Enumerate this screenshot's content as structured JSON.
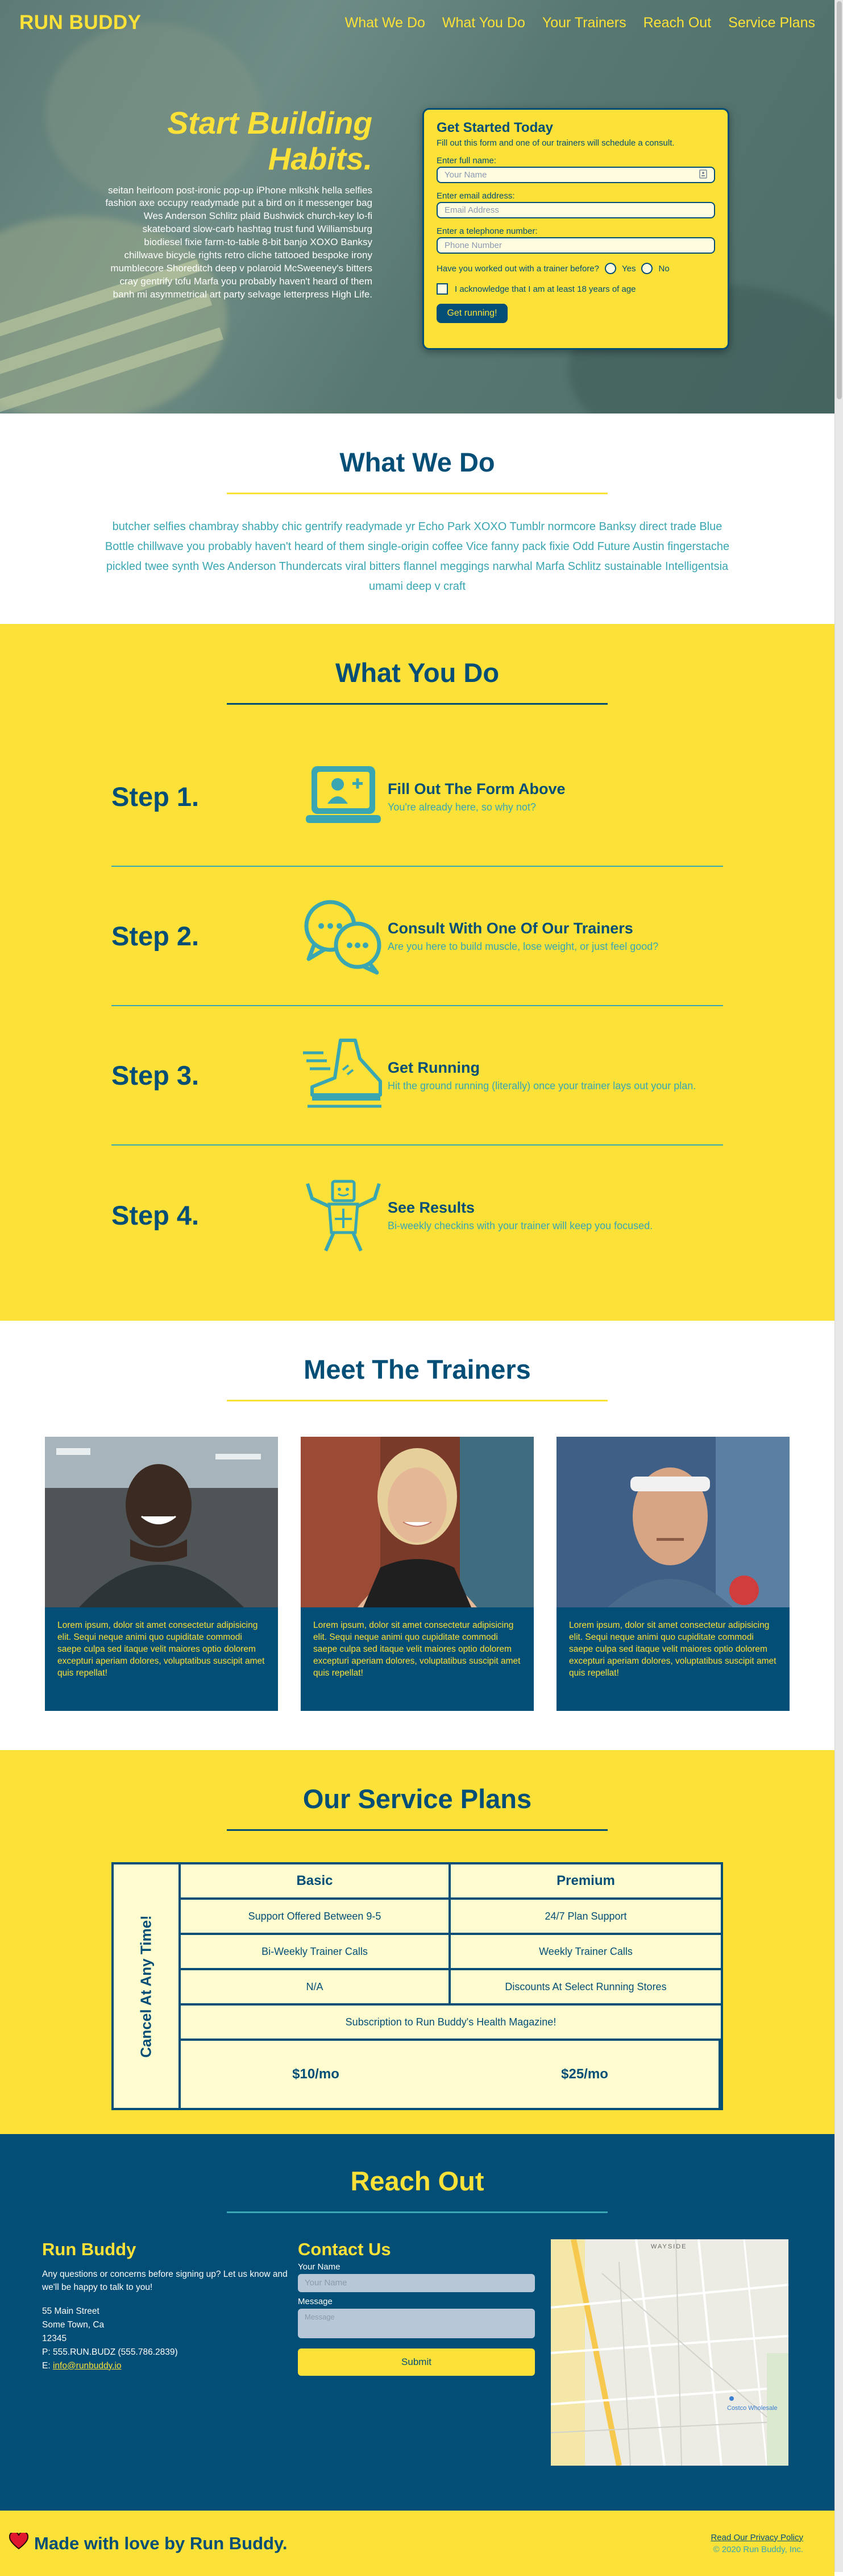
{
  "header": {
    "logo": "RUN BUDDY",
    "nav": [
      "What We Do",
      "What You Do",
      "Your Trainers",
      "Reach Out",
      "Service Plans"
    ]
  },
  "hero": {
    "title": "Start Building Habits.",
    "text": "seitan heirloom post-ironic pop-up iPhone mlkshk hella selfies fashion axe occupy readymade put a bird on it messenger bag Wes Anderson Schlitz plaid Bushwick church-key lo-fi skateboard slow-carb hashtag trust fund Williamsburg biodiesel fixie farm-to-table 8-bit banjo XOXO Banksy chillwave bicycle rights retro cliche tattooed bespoke irony mumblecore Shoreditch deep v polaroid McSweeney's bitters cray gentrify tofu Marfa you probably haven't heard of them banh mi asymmetrical art party selvage letterpress High Life."
  },
  "signup": {
    "title": "Get Started Today",
    "subtitle": "Fill out this form and one of our trainers will schedule a consult.",
    "name_label": "Enter full name:",
    "name_placeholder": "Your Name",
    "email_label": "Enter email address:",
    "email_placeholder": "Email Address",
    "phone_label": "Enter a telephone number:",
    "phone_placeholder": "Phone Number",
    "question": "Have you worked out with a trainer before?",
    "yes": "Yes",
    "no": "No",
    "ack": "I acknowledge that I am at least 18 years of age",
    "button": "Get running!"
  },
  "what_we_do": {
    "title": "What We Do",
    "text": "butcher selfies chambray shabby chic gentrify readymade yr Echo Park XOXO Tumblr normcore Banksy direct trade Blue Bottle chillwave you probably haven't heard of them single-origin coffee Vice fanny pack fixie Odd Future Austin fingerstache pickled twee synth Wes Anderson Thundercats viral bitters flannel meggings narwhal Marfa Schlitz sustainable Intelligentsia umami deep v craft"
  },
  "what_you_do": {
    "title": "What You Do",
    "steps": [
      {
        "num": "Step 1.",
        "title": "Fill Out The Form Above",
        "desc": "You're already here, so why not?",
        "icon": "laptop-user-icon"
      },
      {
        "num": "Step 2.",
        "title": "Consult With One Of Our Trainers",
        "desc": "Are you here to build muscle, lose weight, or just feel good?",
        "icon": "chat-bubbles-icon"
      },
      {
        "num": "Step 3.",
        "title": "Get Running",
        "desc": "Hit the ground running (literally) once your trainer lays out your plan.",
        "icon": "running-shoe-icon"
      },
      {
        "num": "Step 4.",
        "title": "See Results",
        "desc": "Bi-weekly checkins with your trainer will keep you focused.",
        "icon": "strong-body-icon"
      }
    ]
  },
  "trainers": {
    "title": "Meet The Trainers",
    "cards": [
      {
        "text": "Lorem ipsum, dolor sit amet consectetur adipisicing elit. Sequi neque animi quo cupiditate commodi saepe culpa sed itaque velit maiores optio dolorem excepturi aperiam dolores, voluptatibus suscipit amet quis repellat!"
      },
      {
        "text": "Lorem ipsum, dolor sit amet consectetur adipisicing elit. Sequi neque animi quo cupiditate commodi saepe culpa sed itaque velit maiores optio dolorem excepturi aperiam dolores, voluptatibus suscipit amet quis repellat!"
      },
      {
        "text": "Lorem ipsum, dolor sit amet consectetur adipisicing elit. Sequi neque animi quo cupiditate commodi saepe culpa sed itaque velit maiores optio dolorem excepturi aperiam dolores, voluptatibus suscipit amet quis repellat!"
      }
    ]
  },
  "plans": {
    "title": "Our Service Plans",
    "side": "Cancel At Any Time!",
    "basic": "Basic",
    "premium": "Premium",
    "rows": [
      [
        "Support Offered Between 9-5",
        "24/7 Plan Support"
      ],
      [
        "Bi-Weekly Trainer Calls",
        "Weekly Trainer Calls"
      ],
      [
        "N/A",
        "Discounts At Select Running Stores"
      ]
    ],
    "shared": "Subscription to Run Buddy's Health Magazine!",
    "basic_price": "$10/mo",
    "premium_price": "$25/mo"
  },
  "reach": {
    "title": "Reach Out",
    "company": "Run Buddy",
    "intro": "Any questions or concerns before signing up? Let us know and we'll be happy to talk to you!",
    "address1": "55 Main Street",
    "address2": "Some Town, Ca",
    "zip": "12345",
    "phone": "P: 555.RUN.BUDZ (555.786.2839)",
    "email_prefix": "E: ",
    "email": "info@runbuddy.io",
    "contact_title": "Contact Us",
    "name_label": "Your Name",
    "name_placeholder": "Your Name",
    "message_label": "Message",
    "message_placeholder": "Message",
    "submit": "Submit",
    "map_label_top": "WAYSIDE",
    "map_label_store": "Costco Wholesale"
  },
  "footer": {
    "made": "Made with love by Run Buddy.",
    "privacy": "Read Our Privacy Policy",
    "copyright": "© 2020 Run Buddy, Inc."
  }
}
